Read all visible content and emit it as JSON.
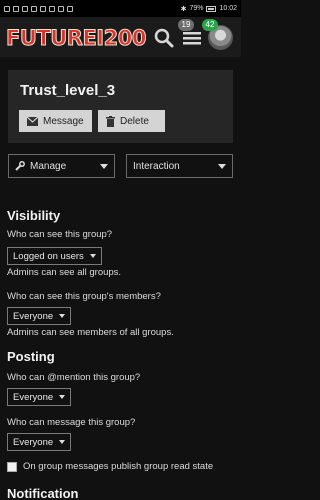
{
  "status_bar": {
    "left_icons": [
      "sim-icon",
      "signal-icon",
      "alarm-icon",
      "message-icon",
      "whatsapp-icon",
      "media-icon",
      "camera-icon",
      "gallery-icon"
    ],
    "battery": "79%",
    "time": "10:02"
  },
  "header": {
    "logo_text": "FUTUREI200",
    "notifications_count": "19",
    "messages_count": "42"
  },
  "group": {
    "title": "Trust_level_3",
    "message_label": "Message",
    "delete_label": "Delete"
  },
  "toolbar": {
    "manage_label": "Manage",
    "interaction_label": "Interaction"
  },
  "visibility": {
    "heading": "Visibility",
    "see_group_label": "Who can see this group?",
    "see_group_value": "Logged on users",
    "see_group_note": "Admins can see all groups.",
    "see_members_label": "Who can see this group's members?",
    "see_members_value": "Everyone",
    "see_members_note": "Admins can see members of all groups."
  },
  "posting": {
    "heading": "Posting",
    "mention_label": "Who can @mention this group?",
    "mention_value": "Everyone",
    "message_label": "Who can message this group?",
    "message_value": "Everyone",
    "read_state_label": "On group messages publish group read state"
  },
  "notification": {
    "heading": "Notification"
  }
}
